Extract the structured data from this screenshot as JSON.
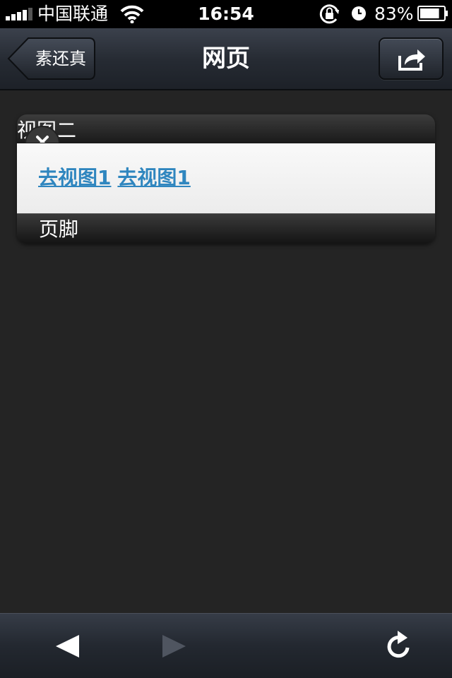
{
  "status_bar": {
    "carrier": "中国联通",
    "time": "16:54",
    "battery": "83%",
    "battery_level": 0.83,
    "icons": [
      "signal-bars-icon",
      "wifi-icon",
      "rotation-lock-icon",
      "alarm-icon",
      "battery-icon"
    ]
  },
  "nav_bar": {
    "back_label": "素还真",
    "title": "网页",
    "share_icon": "share-icon"
  },
  "panel": {
    "header_title": "视图二",
    "links": [
      "去视图1",
      "去视图1"
    ],
    "footer_title": "页脚",
    "close_icon": "close-icon"
  },
  "toolbar": {
    "back_icon": "back-arrow-icon",
    "forward_icon": "forward-arrow-icon",
    "forward_enabled": false,
    "reload_icon": "reload-icon"
  },
  "colors": {
    "background": "#242424",
    "link": "#2f86bf",
    "nav_bar": "#2a2f37",
    "panel_body": "#f4f4f4"
  }
}
